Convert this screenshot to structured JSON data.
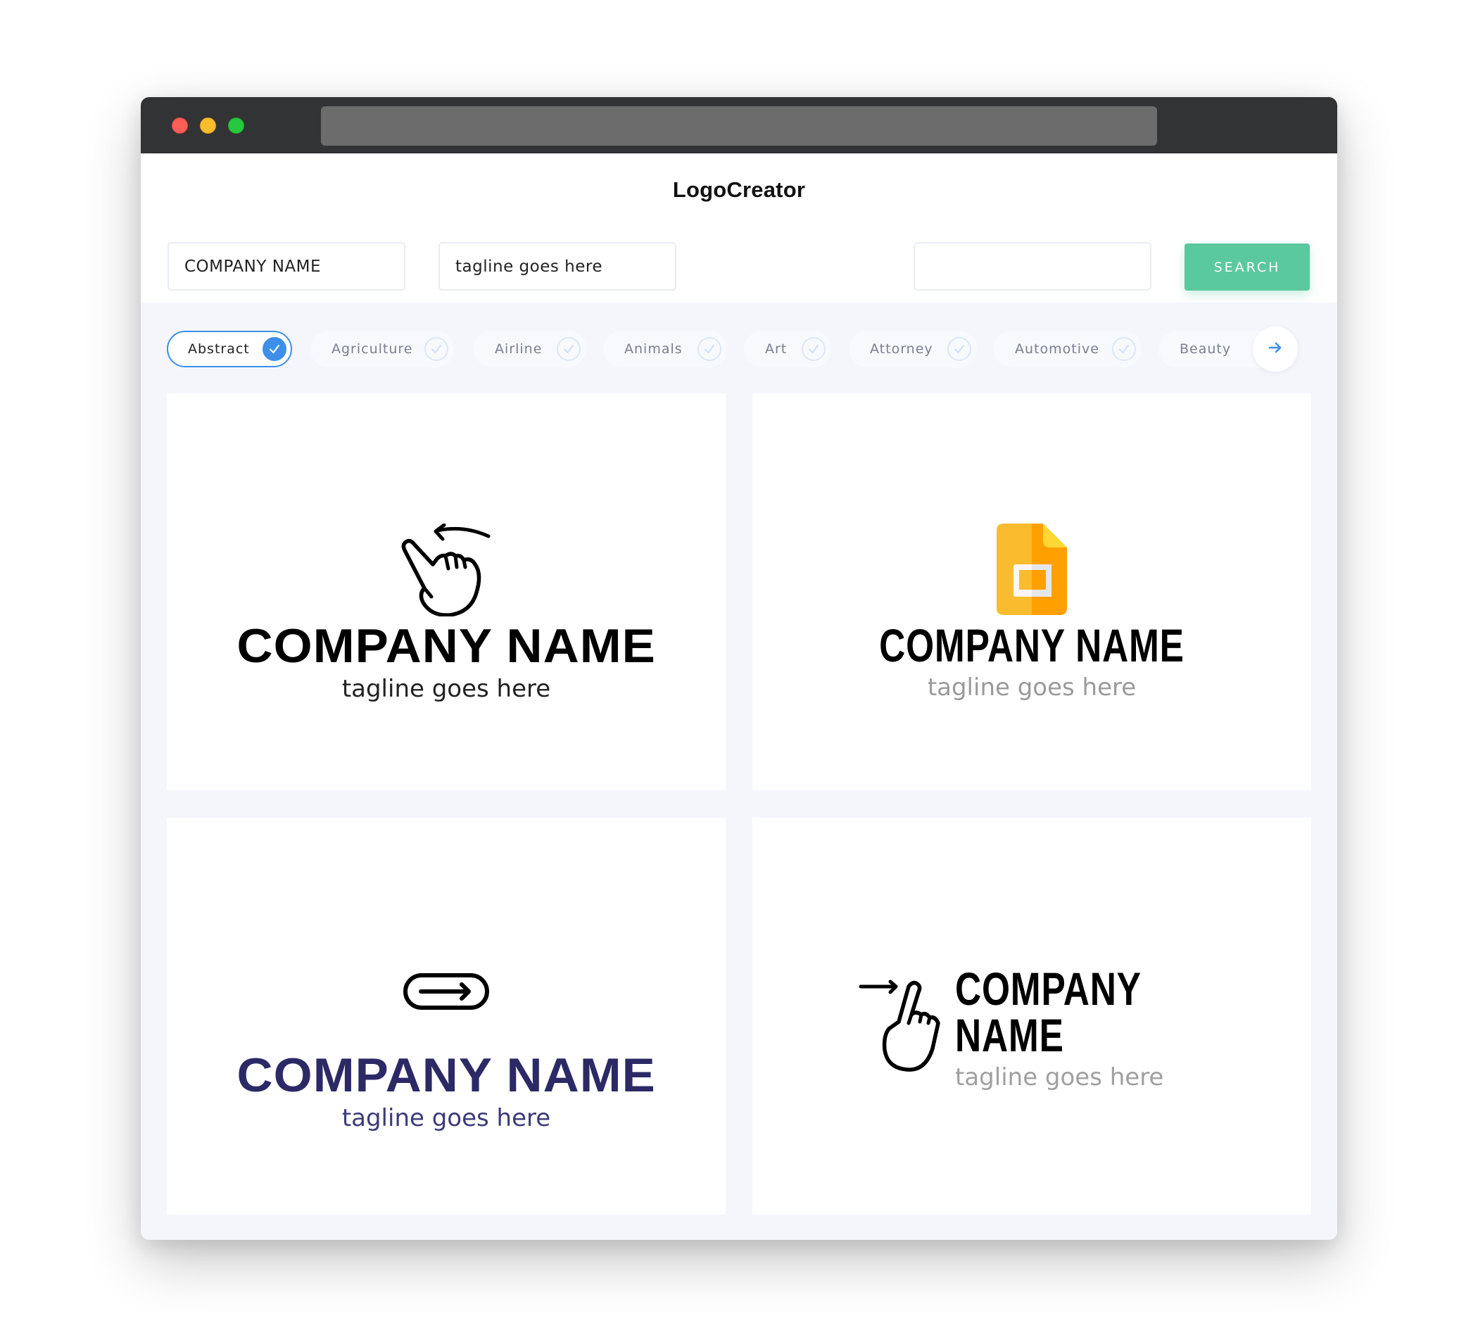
{
  "window": {
    "controls": [
      "close",
      "minimize",
      "maximize"
    ]
  },
  "header": {
    "title": "LogoCreator"
  },
  "search": {
    "company_name_value": "COMPANY NAME",
    "tagline_value": "tagline goes here",
    "keyword_value": "",
    "button_label": "SEARCH"
  },
  "categories": {
    "items": [
      {
        "label": "Abstract",
        "selected": true
      },
      {
        "label": "Agriculture",
        "selected": false
      },
      {
        "label": "Airline",
        "selected": false
      },
      {
        "label": "Animals",
        "selected": false
      },
      {
        "label": "Art",
        "selected": false
      },
      {
        "label": "Attorney",
        "selected": false
      },
      {
        "label": "Automotive",
        "selected": false
      },
      {
        "label": "Beauty",
        "selected": false
      }
    ],
    "next_icon": "arrow-right-icon"
  },
  "logos": [
    {
      "icon": "swipe-left-hand-icon",
      "name": "COMPANY NAME",
      "tagline": "tagline goes here",
      "name_color": "#000000",
      "tagline_color": "#222222",
      "layout": "stacked"
    },
    {
      "icon": "slides-document-icon",
      "name": "COMPANY NAME",
      "tagline": "tagline goes here",
      "name_color": "#000000",
      "tagline_color": "#9a9a9a",
      "layout": "stacked"
    },
    {
      "icon": "arrow-pill-icon",
      "name": "COMPANY NAME",
      "tagline": "tagline goes here",
      "name_color": "#2b2a66",
      "tagline_color": "#3b3a7a",
      "layout": "stacked"
    },
    {
      "icon": "swipe-right-hand-icon",
      "name": "COMPANY NAME",
      "tagline": "tagline goes here",
      "name_color": "#000000",
      "tagline_color": "#a0a0a0",
      "layout": "horizontal"
    }
  ],
  "colors": {
    "accent_blue": "#3d8fe8",
    "search_green": "#5bc99e",
    "titlebar": "#323335",
    "slides_yellow": "#f8bc2e",
    "slides_orange": "#ffa000",
    "navy": "#2b2a66"
  }
}
